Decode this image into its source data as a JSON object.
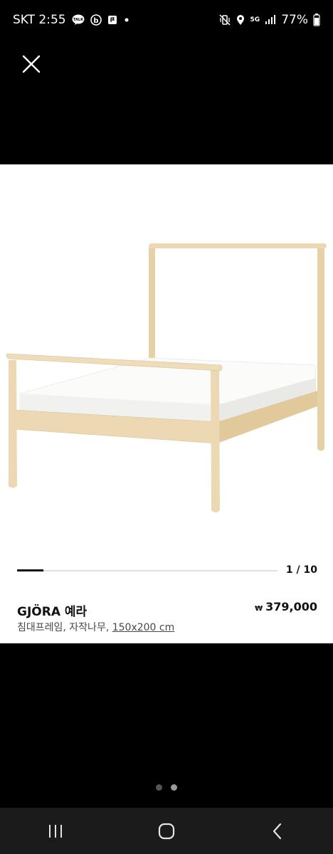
{
  "status_bar": {
    "carrier_time": "SKT 2:55",
    "battery": "77%",
    "net_label": "5G",
    "icons": [
      "talk-icon",
      "b-app-icon",
      "flag-icon",
      "dot-icon",
      "mute-vibrate-icon",
      "location-icon",
      "5g-icon",
      "signal-icon",
      "battery-icon"
    ]
  },
  "close_icon": "close-icon",
  "gallery": {
    "page_indicator": "1 / 10",
    "progress": 0.1
  },
  "product": {
    "name": "GJÖRA 예라",
    "currency": "₩",
    "price": "379,000",
    "desc_prefix": "침대프레임, 자작나무, ",
    "size": "150x200 cm"
  },
  "pager": {
    "count": 2,
    "active_index": 1
  },
  "nav": {
    "recents_icon": "recents-icon",
    "home_icon": "home-icon",
    "back_icon": "back-icon"
  },
  "colors": {
    "wood": "#ecd9b4",
    "wood_dark": "#d8c195",
    "mattress": "#fbfbf9",
    "background": "#000000"
  }
}
